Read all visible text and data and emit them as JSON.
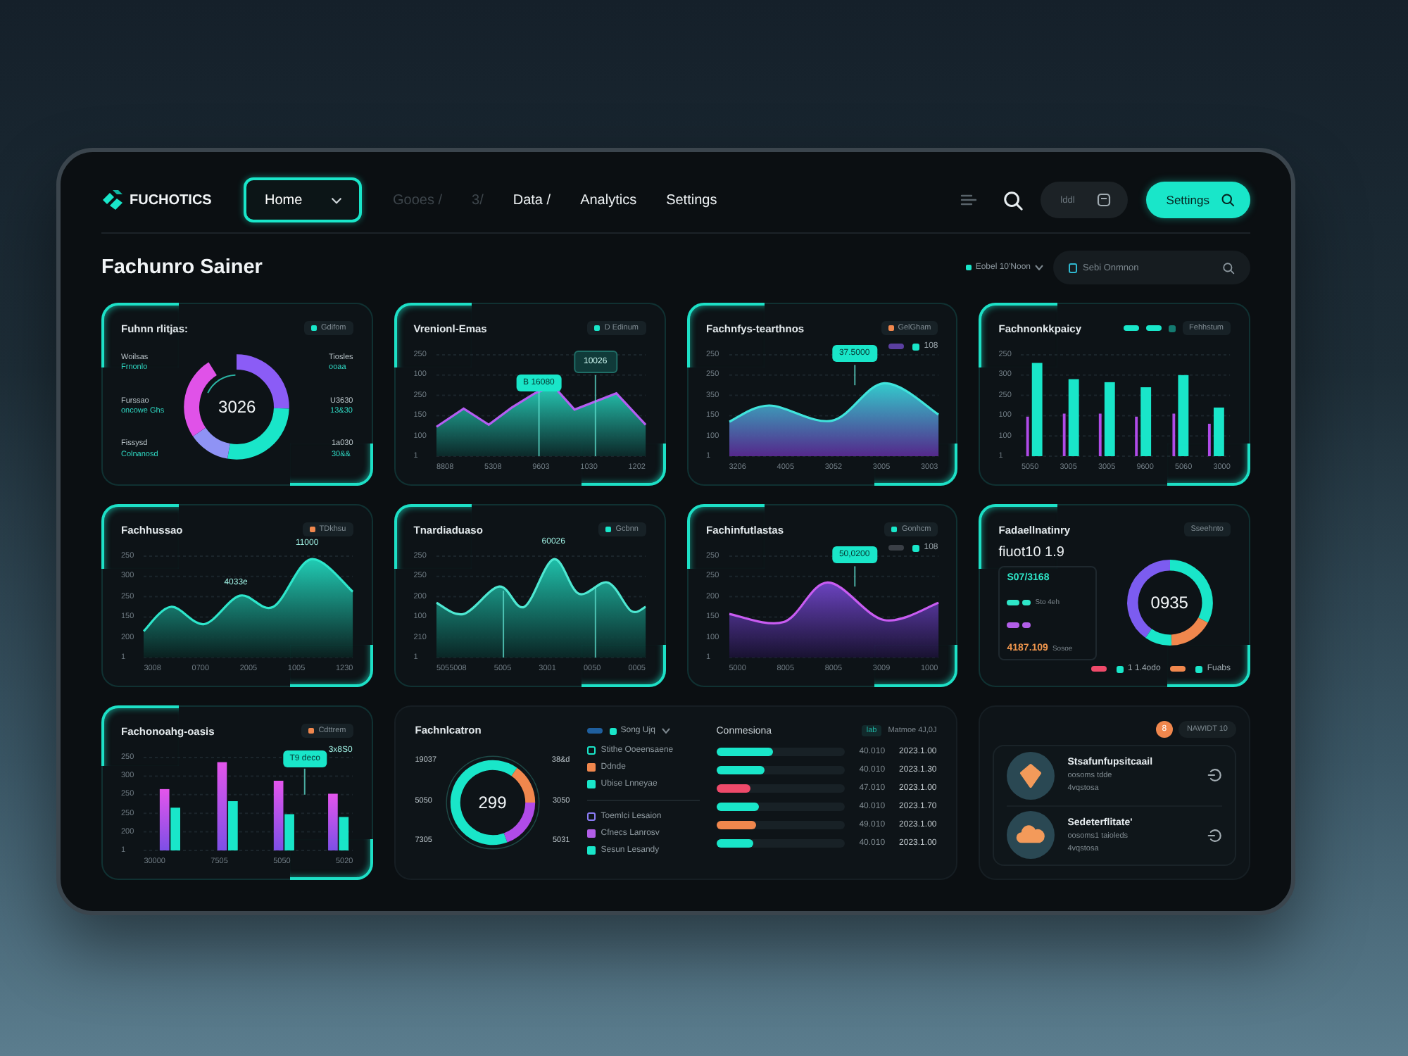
{
  "header": {
    "logo": "FUCHOTICS",
    "home_dropdown": {
      "label": "Home"
    },
    "nav": [
      {
        "label": "Gooes /",
        "disabled": true
      },
      {
        "label": "3/",
        "disabled": true
      },
      {
        "label": "Data /",
        "disabled": false
      },
      {
        "label": "Analytics",
        "disabled": false
      },
      {
        "label": "Settings",
        "disabled": false
      }
    ],
    "toolbar_pill": {
      "label": "lddl"
    },
    "settings_button": {
      "label": "Settings"
    }
  },
  "page": {
    "title": "Fachunro Sainer",
    "filter": {
      "label": "Eobel 10'Noon"
    },
    "search": {
      "placeholder": "Sebi Onmnon"
    }
  },
  "cards": [
    {
      "kind": "donut",
      "title": "Fuhnn rlitjas:",
      "badge": {
        "label": "Gdifom",
        "color": "#19e6c9"
      },
      "center": "3026",
      "labels": [
        {
          "title": "Woilsas",
          "sub": "Frnonlo"
        },
        {
          "title": "Furssao",
          "sub": "oncowe Ghs"
        },
        {
          "title": "Fissysd",
          "sub": "Colnanosd"
        },
        {
          "title": "Tiosles",
          "sub": "ooaa"
        },
        {
          "title": "U3630",
          "sub": "13&30"
        },
        {
          "title": "1a030",
          "sub": "30&&"
        }
      ]
    },
    {
      "kind": "area",
      "title": "Vrenionl-Emas",
      "badge": {
        "label": "D Edinum",
        "color": "#19e6c9"
      },
      "callouts": [
        {
          "label": "B 16080",
          "kind": "filled"
        },
        {
          "label": "10026",
          "kind": "dark"
        }
      ],
      "y_labels": [
        "250",
        "100",
        "250",
        "150",
        "100",
        "1"
      ],
      "x_labels": [
        "8808",
        "5308",
        "9603",
        "1030",
        "1202"
      ]
    },
    {
      "kind": "area",
      "title": "Fachnfys-tearthnos",
      "badge": {
        "label": "GelGham",
        "color": "#f0874d"
      },
      "legend": [
        {
          "kind": "pill",
          "color": "#5b3fa0"
        },
        {
          "kind": "dot",
          "color": "#19e6c9",
          "label": "108"
        }
      ],
      "callouts": [
        {
          "label": "37.5000",
          "kind": "filled"
        }
      ],
      "y_labels": [
        "250",
        "250",
        "350",
        "150",
        "100",
        "1"
      ],
      "x_labels": [
        "3206",
        "4005",
        "3052",
        "3005",
        "3003"
      ]
    },
    {
      "kind": "bars",
      "title": "Fachnonkkpaicy",
      "badge": {
        "label": "Fehhstum"
      },
      "legend": [
        {
          "kind": "pill",
          "color": "#19e6c9"
        },
        {
          "kind": "pill",
          "color": "#19e6c9"
        },
        {
          "kind": "dot",
          "color": "#147a70"
        }
      ],
      "y_labels": [
        "250",
        "300",
        "250",
        "100",
        "100",
        "1"
      ],
      "x_labels": [
        "5050",
        "3005",
        "3005",
        "9600",
        "5060",
        "3000"
      ]
    },
    {
      "kind": "area",
      "title": "Fachhussao",
      "badge": {
        "label": "TDkhsu",
        "color": "#f0874d"
      },
      "callouts": [
        {
          "label": "11000",
          "kind": "plain"
        },
        {
          "label": "4033e",
          "kind": "plain"
        }
      ],
      "y_labels": [
        "250",
        "300",
        "250",
        "150",
        "200",
        "1"
      ],
      "x_labels": [
        "3008",
        "0700",
        "2005",
        "1005",
        "1230"
      ]
    },
    {
      "kind": "area",
      "title": "Tnardiaduaso",
      "badge": {
        "label": "Gcbnn",
        "color": "#19e6c9"
      },
      "callouts": [
        {
          "label": "60026",
          "kind": "plain"
        }
      ],
      "y_labels": [
        "250",
        "250",
        "200",
        "100",
        "210",
        "1"
      ],
      "x_labels": [
        "5055008",
        "5005",
        "3001",
        "0050",
        "0005"
      ]
    },
    {
      "kind": "area",
      "title": "Fachinfutlastas",
      "badge": {
        "label": "Gonhcm",
        "color": "#19e6c9"
      },
      "legend": [
        {
          "kind": "pill",
          "color": "#3a3f46"
        },
        {
          "kind": "dot",
          "color": "#19e6c9",
          "label": "108"
        }
      ],
      "callouts": [
        {
          "label": "50,0200",
          "kind": "filled"
        }
      ],
      "y_labels": [
        "250",
        "250",
        "200",
        "150",
        "100",
        "1"
      ],
      "x_labels": [
        "5000",
        "8005",
        "8005",
        "3009",
        "1000"
      ]
    },
    {
      "kind": "stats",
      "title": "Fadaellnatinry",
      "badge": {
        "label": "Sseehnto"
      },
      "headline": "fiuot10 1.9",
      "stats": [
        {
          "kind": "value",
          "label": "S07/3168",
          "color": "#2ee6c8"
        },
        {
          "kind": "chips",
          "label": "Sto 4eh",
          "color": "#2ee6c8"
        },
        {
          "kind": "chips",
          "color": "#b25ee8"
        },
        {
          "kind": "value",
          "label": "4187.109",
          "note": "Sosoe",
          "color": "#f0964d"
        }
      ],
      "center": "0935",
      "legend": [
        {
          "kind": "pill",
          "color": "#ef4a6a"
        },
        {
          "kind": "dot",
          "color": "#19e6c9",
          "label": "1 1.4odo"
        },
        {
          "kind": "pill",
          "color": "#f0874d"
        },
        {
          "kind": "dot",
          "color": "#19e6c9",
          "label": "Fuabs"
        }
      ]
    },
    {
      "kind": "bars",
      "title": "Fachonoahg-oasis",
      "badge": {
        "label": "Cdttrem",
        "color": "#f0874d"
      },
      "callouts": [
        {
          "label": "T9 deco",
          "kind": "filled"
        },
        {
          "label": "3x8S0",
          "kind": "plain"
        }
      ],
      "y_labels": [
        "250",
        "300",
        "250",
        "250",
        "200",
        "1"
      ],
      "x_labels": [
        "30000",
        "7505",
        "5050",
        "5020"
      ]
    },
    {
      "kind": "breakdown",
      "title": "Fachnlcatron",
      "center": "299",
      "labels": [
        {
          "title": "19037"
        },
        {
          "title": "5050"
        },
        {
          "title": "7305"
        },
        {
          "title": "38&d"
        },
        {
          "title": "3050"
        },
        {
          "title": "5031"
        }
      ],
      "legend": [
        {
          "kind": "pill",
          "color": "#1f5f9e"
        },
        {
          "kind": "dot",
          "color": "#19e6c9",
          "label": "Song Ujq"
        }
      ],
      "legend_groups": [
        {
          "items": [
            {
              "label": "Stithe Ooeensaene",
              "kind": "outline",
              "color": "#19e6c9"
            },
            {
              "label": "Ddnde",
              "kind": "solid",
              "color": "#f0874d"
            },
            {
              "label": "Ubise Lnneyae",
              "kind": "solid",
              "color": "#19e6c9"
            }
          ]
        },
        {
          "items": [
            {
              "label": "Toemlci Lesaion",
              "kind": "outline",
              "color": "#8b7cf6"
            },
            {
              "label": "Cfnecs Lanrosv",
              "kind": "solid",
              "color": "#b25ee8"
            },
            {
              "label": "Sesun Lesandy",
              "kind": "solid",
              "color": "#19e6c9"
            }
          ]
        }
      ],
      "rows_heading": "Conmesiona",
      "rows_tag": "lab",
      "rows_note": "Matmoe 4J,0J",
      "rows": [
        {
          "level": 0.44,
          "color": "#19e6c9",
          "value": "40.010",
          "date": "2023.1.00"
        },
        {
          "level": 0.38,
          "color": "#19e6c9",
          "value": "40.010",
          "date": "2023.1.30"
        },
        {
          "level": 0.26,
          "color": "#ef4a6a",
          "value": "47.010",
          "date": "2023.1.00"
        },
        {
          "level": 0.33,
          "color": "#19e6c9",
          "value": "40.010",
          "date": "2023.1.70"
        },
        {
          "level": 0.31,
          "color": "#f0874d",
          "value": "49.010",
          "date": "2023.1.00"
        },
        {
          "level": 0.29,
          "color": "#19e6c9",
          "value": "40.010",
          "date": "2023.1.00"
        }
      ]
    },
    {
      "kind": "contacts",
      "badge": {
        "label": "8"
      },
      "chip": {
        "label": "NAWIDT 10"
      },
      "items": [
        {
          "name": "Stsafunfupsitcaail",
          "detail": "oosoms tdde",
          "meta": "4vqstosa"
        },
        {
          "name": "Sedeterflitate'",
          "detail": "oosoms1 taioleds",
          "meta": "4vqstosa"
        }
      ]
    }
  ]
}
